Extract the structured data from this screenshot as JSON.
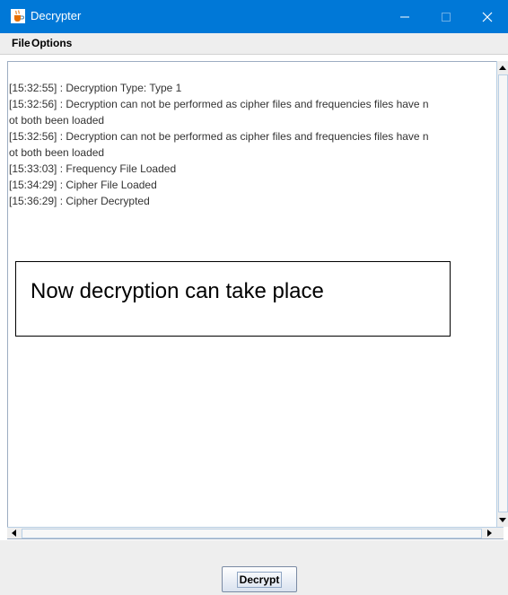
{
  "window": {
    "title": "Decrypter",
    "accent_color": "#0078d7",
    "icon": "java-cup-icon"
  },
  "menubar": {
    "items": [
      "File",
      "Options"
    ]
  },
  "log": {
    "lines": [
      "[15:32:55] : Decryption Type: Type 1",
      "[15:32:56] : Decryption can not be performed as cipher files and frequencies files have n",
      "ot both been loaded",
      "[15:32:56] : Decryption can not be performed as cipher files and frequencies files have n",
      "ot both been loaded",
      "[15:33:03] : Frequency File Loaded",
      "[15:34:29] : Cipher File Loaded",
      "[15:36:29] : Cipher Decrypted"
    ]
  },
  "annotation": {
    "text": "Now decryption can take place"
  },
  "actions": {
    "decrypt_label": "Decrypt"
  }
}
